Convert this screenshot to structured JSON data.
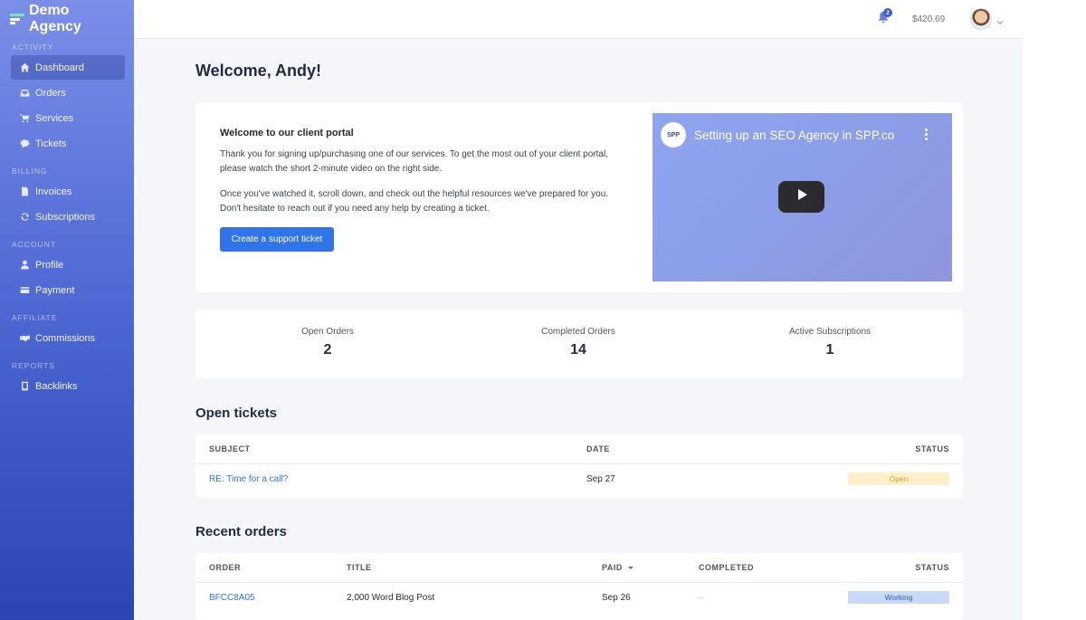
{
  "brand": {
    "name": "Demo Agency"
  },
  "sidebar": {
    "sections": [
      {
        "label": "ACTIVITY",
        "items": [
          {
            "label": "Dashboard",
            "icon": "home-icon",
            "active": true
          },
          {
            "label": "Orders",
            "icon": "inbox-icon"
          },
          {
            "label": "Services",
            "icon": "cart-icon"
          },
          {
            "label": "Tickets",
            "icon": "chat-icon"
          }
        ]
      },
      {
        "label": "BILLING",
        "items": [
          {
            "label": "Invoices",
            "icon": "file-icon"
          },
          {
            "label": "Subscriptions",
            "icon": "refresh-icon"
          }
        ]
      },
      {
        "label": "ACCOUNT",
        "items": [
          {
            "label": "Profile",
            "icon": "user-icon"
          },
          {
            "label": "Payment",
            "icon": "credit-card-icon"
          }
        ]
      },
      {
        "label": "AFFILIATE",
        "items": [
          {
            "label": "Commissions",
            "icon": "handshake-icon"
          }
        ]
      },
      {
        "label": "REPORTS",
        "items": [
          {
            "label": "Backlinks",
            "icon": "book-icon"
          }
        ]
      }
    ]
  },
  "topbar": {
    "notification_count": "2",
    "balance": "$420.69"
  },
  "page": {
    "title": "Welcome, Andy!"
  },
  "welcome": {
    "heading": "Welcome to our client portal",
    "paragraph1": "Thank you for signing up/purchasing one of our services. To get the most out of your client portal, please watch the short 2-minute video on the right side.",
    "paragraph2": "Once you've watched it, scroll down, and check out the helpful resources we've prepared for you. Don't hesitate to reach out if you need any help by creating a ticket.",
    "button_label": "Create a support ticket",
    "video": {
      "logo_text": "SPP",
      "title": "Setting up an SEO Agency in SPP.co"
    }
  },
  "stats": [
    {
      "label": "Open Orders",
      "value": "2"
    },
    {
      "label": "Completed Orders",
      "value": "14"
    },
    {
      "label": "Active Subscriptions",
      "value": "1"
    }
  ],
  "tickets": {
    "title": "Open tickets",
    "headers": {
      "subject": "SUBJECT",
      "date": "DATE",
      "status": "STATUS"
    },
    "rows": [
      {
        "subject": "RE: Time for a call?",
        "date": "Sep 27",
        "status": "Open"
      }
    ]
  },
  "orders": {
    "title": "Recent orders",
    "headers": {
      "order": "ORDER",
      "title": "TITLE",
      "paid": "PAID",
      "completed": "COMPLETED",
      "status": "STATUS"
    },
    "rows": [
      {
        "order": "BFCC8A05",
        "title": "2,000 Word Blog Post",
        "paid": "Sep 26",
        "completed": "–",
        "status": "Working"
      }
    ]
  },
  "colors": {
    "accent": "#2f74e9",
    "sidebar_top": "#7b8fe8",
    "sidebar_bottom": "#2a47b1",
    "open_badge": "#fdf0c8",
    "working_badge": "#c9d9f8"
  }
}
